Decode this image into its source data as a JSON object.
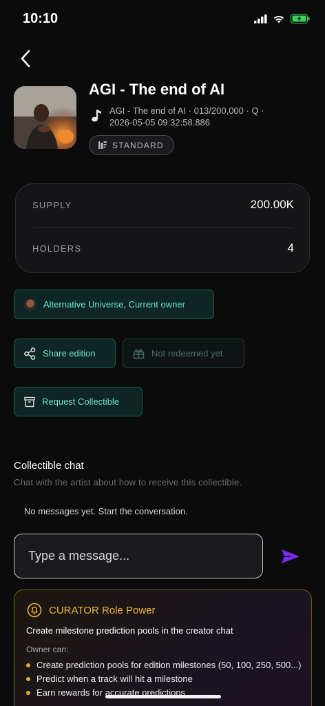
{
  "status_bar": {
    "time": "10:10"
  },
  "collectible": {
    "title": "AGI - The end of AI",
    "meta": "AGI - The end of AI · 013/200,000 · Q · 2026-05-05 09:32:58.886",
    "tier": "STANDARD"
  },
  "stats": {
    "supply_label": "SUPPLY",
    "supply_value": "200.00K",
    "holders_label": "HOLDERS",
    "holders_value": "4"
  },
  "owner_pill": {
    "label": "Alternative Universe, Current owner"
  },
  "actions": {
    "share_label": "Share edition",
    "redeem_label": "Not redeemed yet",
    "request_label": "Request Collectible"
  },
  "chat": {
    "title": "Collectible chat",
    "subtitle": "Chat with the artist about how to receive this collectible.",
    "empty": "No messages yet. Start the conversation.",
    "placeholder": "Type a message..."
  },
  "power_card": {
    "title": "CURATOR Role Power",
    "description": "Create milestone prediction pools in the creator chat",
    "owner_can": "Owner can:",
    "items": [
      "Create prediction pools for edition milestones (50, 100, 250, 500...)",
      "Predict when a track will hit a milestone",
      "Earn rewards for accurate predictions"
    ]
  },
  "colors": {
    "accent_green": "#6fe3c5",
    "accent_gold": "#f0b43c",
    "send_purple": "#7b2cf0"
  }
}
